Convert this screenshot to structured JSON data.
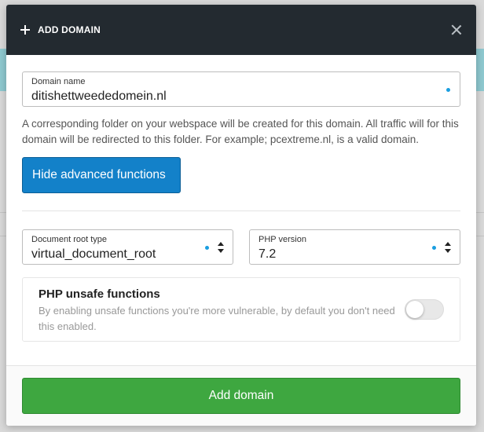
{
  "modal": {
    "title": "ADD DOMAIN",
    "icons": {
      "add": "plus-icon",
      "close": "close-icon",
      "sort": "sort-arrows-icon"
    }
  },
  "domain_field": {
    "label": "Domain name",
    "value": "ditishettweededomein.nl"
  },
  "help_text": "A corresponding folder on your webspace will be created for this domain. All traffic will for this domain will be redirected to this folder. For example; pcextreme.nl, is a valid domain.",
  "advanced_button": {
    "label": "Hide advanced functions"
  },
  "document_root": {
    "label": "Document root type",
    "value": "virtual_document_root"
  },
  "php_version": {
    "label": "PHP version",
    "value": "7.2"
  },
  "unsafe": {
    "title": "PHP unsafe functions",
    "description": "By enabling unsafe functions you're more vulnerable, by default you don't need this enabled.",
    "enabled": false
  },
  "footer": {
    "add_label": "Add domain"
  },
  "colors": {
    "header": "#232a30",
    "primary_button": "#1381c9",
    "success_button": "#3ea740",
    "required_dot": "#1a9ee0"
  }
}
